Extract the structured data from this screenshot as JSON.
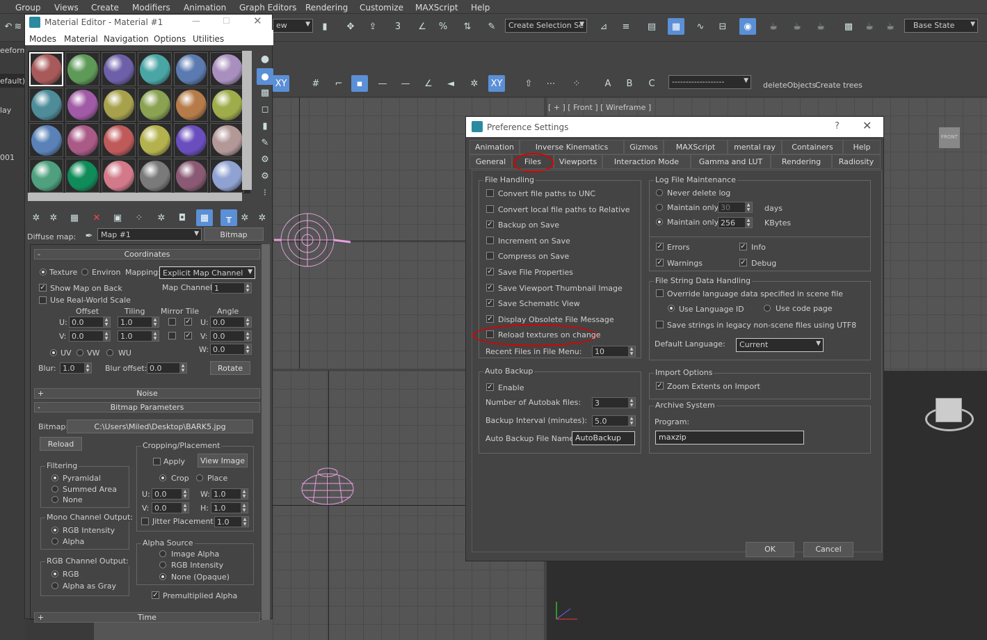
{
  "menu": [
    "Group",
    "Views",
    "Create",
    "Modifiers",
    "Animation",
    "Graph Editors",
    "Rendering",
    "Customize",
    "MAXScript",
    "Help"
  ],
  "toolbar": {
    "view_combo": "ew",
    "selection_set": "Create Selection Se",
    "state": "Base State"
  },
  "toolbar2": {
    "named_combo": "-------------------",
    "delete_objects": "deleteObjects",
    "create_trees": "Create trees"
  },
  "left_strip": [
    "eeform",
    "efault)",
    "lay",
    "001"
  ],
  "viewport_label": "[ + ] [ Front ] [ Wireframe ]",
  "viewcube_label": "FRONT",
  "material_editor": {
    "title": "Material Editor - Material #1",
    "menus": [
      "Modes",
      "Material",
      "Navigation",
      "Options",
      "Utilities"
    ],
    "swatches": [
      "#a85a5a",
      "#5e9a57",
      "#6d5fa8",
      "#4aa6a4",
      "#5a7ab0",
      "#a98fbe",
      "#4e8c9a",
      "#a15aa6",
      "#a7a14c",
      "#8aa252",
      "#b57c4a",
      "#9fac4a",
      "#5a82b8",
      "#aa5a86",
      "#c05a5a",
      "#b4b24e",
      "#6a4ebe",
      "#b39898",
      "#4ea07e",
      "#0f8c5a",
      "#d27a8a",
      "#7a7a7a",
      "#8a5a74",
      "#8fa2d2"
    ],
    "diffuse_label": "Diffuse map:",
    "map_name": "Map #1",
    "map_type": "Bitmap",
    "coordinates": {
      "header": "Coordinates",
      "texture": "Texture",
      "environ": "Environ",
      "mapping_label": "Mapping:",
      "mapping": "Explicit Map Channel",
      "show_map_on_back": "Show Map on Back",
      "map_channel_label": "Map Channel:",
      "map_channel": "1",
      "real_world": "Use Real-World Scale",
      "offset": "Offset",
      "tiling": "Tiling",
      "mirror_tile": "Mirror Tile",
      "angle": "Angle",
      "u": "U:",
      "v": "V:",
      "w": "W:",
      "u_offset": "0.0",
      "v_offset": "0.0",
      "u_tiling": "1.0",
      "v_tiling": "1.0",
      "u_angle": "0.0",
      "v_angle": "0.0",
      "w_angle": "0.0",
      "uv": "UV",
      "vw": "VW",
      "wu": "WU",
      "blur_label": "Blur:",
      "blur": "1.0",
      "blur_offset_label": "Blur offset:",
      "blur_offset": "0.0",
      "rotate": "Rotate"
    },
    "noise": "Noise",
    "bitmap_params": {
      "header": "Bitmap Parameters",
      "bitmap_label": "Bitmap:",
      "bitmap_path": "C:\\Users\\Miled\\Desktop\\BARK5.jpg",
      "reload": "Reload",
      "cropping": "Cropping/Placement",
      "apply": "Apply",
      "view_image": "View Image",
      "crop": "Crop",
      "place": "Place",
      "u": "U:",
      "v": "V:",
      "w": "W:",
      "h": "H:",
      "u_val": "0.0",
      "v_val": "0.0",
      "w_val": "1.0",
      "h_val": "1.0",
      "jitter": "Jitter Placement:",
      "jitter_val": "1.0",
      "filtering": "Filtering",
      "pyramidal": "Pyramidal",
      "summed": "Summed Area",
      "none": "None",
      "mono": "Mono Channel Output:",
      "rgb_intensity": "RGB Intensity",
      "alpha": "Alpha",
      "rgb_out": "RGB Channel Output:",
      "rgb": "RGB",
      "alpha_gray": "Alpha as Gray",
      "alpha_source": "Alpha Source",
      "image_alpha": "Image Alpha",
      "rgb_int2": "RGB Intensity",
      "none_opaque": "None (Opaque)",
      "premult": "Premultiplied Alpha"
    },
    "time": "Time"
  },
  "prefs": {
    "title": "Preference Settings",
    "help": "?",
    "tabs_row1": [
      "Animation",
      "Inverse Kinematics",
      "Gizmos",
      "MAXScript",
      "mental ray",
      "Containers",
      "Help"
    ],
    "tabs_row2": [
      "General",
      "Files",
      "Viewports",
      "Interaction Mode",
      "Gamma and LUT",
      "Rendering",
      "Radiosity"
    ],
    "file_handling": {
      "title": "File Handling",
      "items": [
        {
          "label": "Convert file paths to UNC",
          "checked": false
        },
        {
          "label": "Convert local file paths to Relative",
          "checked": false
        },
        {
          "label": "Backup on Save",
          "checked": true
        },
        {
          "label": "Increment on Save",
          "checked": false
        },
        {
          "label": "Compress on Save",
          "checked": false
        },
        {
          "label": "Save File Properties",
          "checked": true
        },
        {
          "label": "Save Viewport Thumbnail Image",
          "checked": true
        },
        {
          "label": "Save Schematic View",
          "checked": true
        },
        {
          "label": "Display Obsolete File Message",
          "checked": true
        },
        {
          "label": "Reload textures on change",
          "checked": false
        }
      ],
      "recent_label": "Recent Files in File Menu:",
      "recent": "10"
    },
    "log": {
      "title": "Log File Maintenance",
      "never": "Never delete log",
      "maintain1": "Maintain only",
      "days_val": "30",
      "days": "days",
      "maintain2": "Maintain only",
      "kb_val": "256",
      "kb": "KBytes",
      "errors": "Errors",
      "info": "Info",
      "warnings": "Warnings",
      "debug": "Debug"
    },
    "string_data": {
      "title": "File String Data Handling",
      "override": "Override language data specified in scene file",
      "use_lang": "Use Language ID",
      "use_code": "Use code page",
      "legacy": "Save strings in legacy non-scene files using UTF8",
      "default_lang_label": "Default Language:",
      "default_lang": "Current"
    },
    "autobackup": {
      "title": "Auto Backup",
      "enable": "Enable",
      "num_label": "Number of Autobak files:",
      "num": "3",
      "interval_label": "Backup Interval (minutes):",
      "interval": "5.0",
      "name_label": "Auto Backup File Name:",
      "name": "AutoBackup"
    },
    "import": {
      "title": "Import Options",
      "zoom": "Zoom Extents on Import"
    },
    "archive": {
      "title": "Archive System",
      "program_label": "Program:",
      "program": "maxzip"
    },
    "ok": "OK",
    "cancel": "Cancel"
  }
}
